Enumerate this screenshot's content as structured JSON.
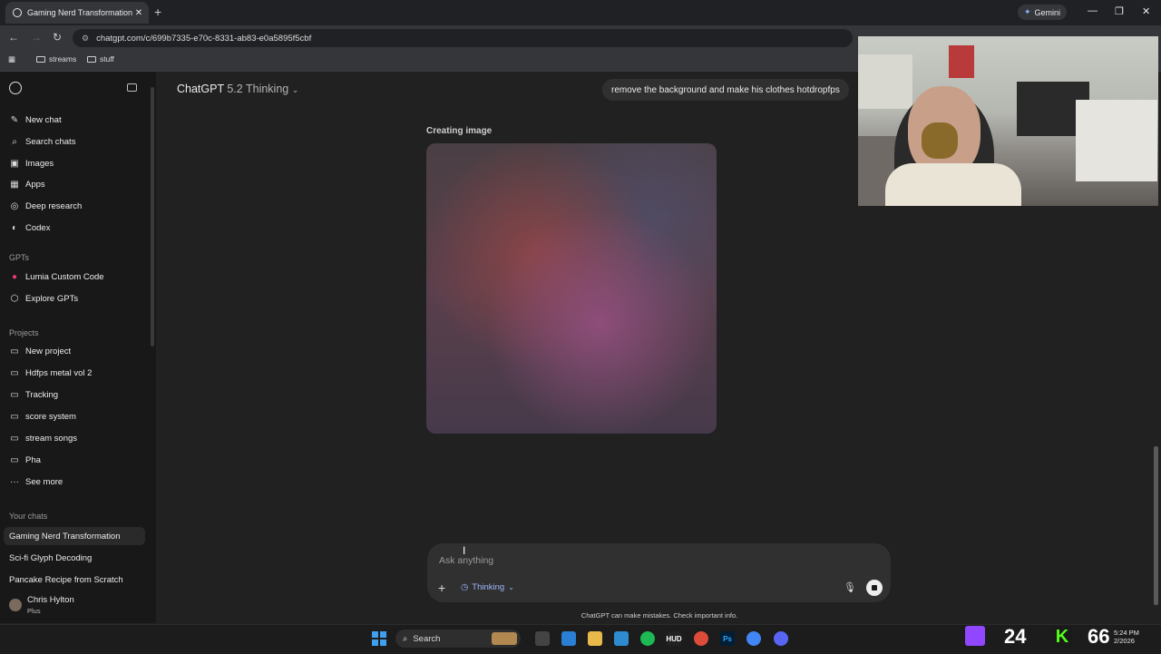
{
  "browser": {
    "tab_title": "Gaming Nerd Transformation",
    "tab_close": "✕",
    "new_tab": "+",
    "gemini_label": "Gemini",
    "url": "chatgpt.com/c/699b7335-e70c-8331-ab83-e0a5895f5cbf",
    "bookmarks": [
      "streams",
      "stuff"
    ],
    "window_controls": [
      "—",
      "❐",
      "✕"
    ]
  },
  "sidebar": {
    "logo_icon": "openai-logo-icon",
    "toggle_icon": "sidebar-toggle-icon",
    "nav": [
      {
        "label": "New chat",
        "icon": "✎"
      },
      {
        "label": "Search chats",
        "icon": "⌕"
      },
      {
        "label": "Images",
        "icon": "▣"
      },
      {
        "label": "Apps",
        "icon": "▦"
      },
      {
        "label": "Deep research",
        "icon": "◎"
      },
      {
        "label": "Codex",
        "icon": "◐"
      }
    ],
    "gpts_heading": "GPTs",
    "gpts": [
      {
        "label": "Lumia Custom Code",
        "icon": "●"
      },
      {
        "label": "Explore GPTs",
        "icon": "⬡"
      }
    ],
    "projects_heading": "Projects",
    "projects": [
      {
        "label": "New project",
        "icon": "▭"
      },
      {
        "label": "Hdfps metal vol 2",
        "icon": "▭"
      },
      {
        "label": "Tracking",
        "icon": "▭"
      },
      {
        "label": "score system",
        "icon": "▭"
      },
      {
        "label": "stream songs",
        "icon": "▭"
      },
      {
        "label": "Pha",
        "icon": "▭"
      },
      {
        "label": "See more",
        "icon": "···"
      }
    ],
    "chats_heading": "Your chats",
    "chats": [
      "Gaming Nerd Transformation",
      "Sci-fi Glyph Decoding",
      "Pancake Recipe from Scratch"
    ],
    "user_name": "Chris Hylton",
    "user_plan": "Plus"
  },
  "main": {
    "model_name": "ChatGPT",
    "model_version": "5.2 Thinking",
    "user_message": "remove the background and make his clothes hotdropfps",
    "status": "Creating image",
    "composer_placeholder": "Ask anything",
    "thinking_label": "Thinking",
    "disclaimer": "ChatGPT can make mistakes. Check important info."
  },
  "taskbar": {
    "search_label": "Search",
    "apps": [
      "HUD",
      "Ps"
    ],
    "counter_a": "24",
    "counter_b": "66",
    "kick_letter": "K",
    "time": "5:24 PM",
    "date": "2/2026"
  },
  "colors": {
    "background": "#212121",
    "sidebar": "#181818",
    "accent_thinking": "#9fb8ff",
    "twitch": "#9146ff",
    "kick": "#53fc18"
  }
}
